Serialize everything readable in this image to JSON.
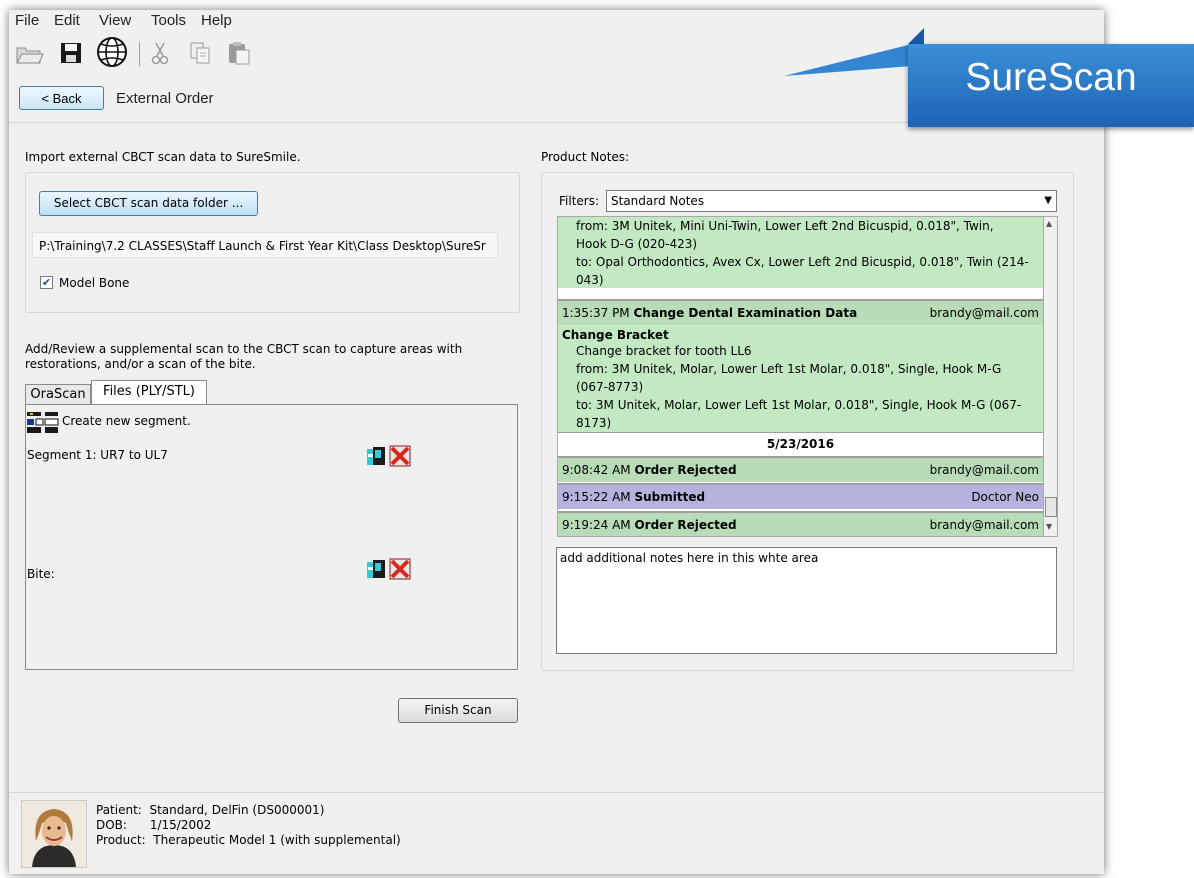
{
  "menu": [
    "File",
    "Edit",
    "View",
    "Tools",
    "Help"
  ],
  "toolbar": {
    "icons": [
      "open-folder-icon",
      "save-icon",
      "globe-icon",
      "cut-icon",
      "copy-icon",
      "paste-icon"
    ]
  },
  "header": {
    "back_label": "< Back",
    "title": "External Order"
  },
  "brand": {
    "name": "SureScan",
    "color": "#2373c4"
  },
  "left": {
    "import_label": "Import external CBCT scan data to SureSmile.",
    "select_button": "Select CBCT scan data folder ...",
    "path": "P:\\Training\\7.2 CLASSES\\Staff Launch & First Year Kit\\Class Desktop\\SureSr",
    "model_bone_label": "Model Bone",
    "model_bone_checked": true,
    "supplemental_text_line1": "Add/Review a supplemental scan to the CBCT scan to capture areas with",
    "supplemental_text_line2": "restorations, and/or a scan of the bite.",
    "tabs": [
      "OraScan",
      "Files (PLY/STL)"
    ],
    "active_tab": "Files (PLY/STL)",
    "create_segment": "Create new segment.",
    "segment_label": "Segment 1: UR7 to UL7",
    "bite_label": "Bite:",
    "finish_button": "Finish Scan"
  },
  "notes": {
    "title": "Product Notes:",
    "filters_label": "Filters:",
    "filter_value": "Standard Notes",
    "top_note_lines": [
      "from: 3M Unitek, Mini Uni-Twin, Lower Left 2nd Bicuspid, 0.018\", Twin,",
      "Hook D-G (020-423)",
      "to: Opal Orthodontics, Avex Cx, Lower Left 2nd Bicuspid, 0.018\", Twin (214-",
      "043)"
    ],
    "rows": [
      {
        "time": "1:35:37 PM",
        "event": "Change Dental Examination Data",
        "user": "brandy@mail.com"
      }
    ],
    "change_bracket": {
      "title": "Change Bracket",
      "lines": [
        "Change bracket for tooth LL6",
        "from: 3M Unitek, Molar, Lower Left 1st Molar, 0.018\", Single, Hook M-G",
        "(067-8773)",
        "to: 3M Unitek, Molar, Lower Left 1st Molar, 0.018\", Single, Hook M-G (067-",
        "8173)"
      ]
    },
    "date": "5/23/2016",
    "rows2": [
      {
        "time": "9:08:42 AM",
        "event": "Order Rejected",
        "user": "brandy@mail.com"
      },
      {
        "time": "9:15:22 AM",
        "event": "Submitted",
        "user": "Doctor Neo"
      },
      {
        "time": "9:19:24 AM",
        "event": "Order Rejected",
        "user": "brandy@mail.com"
      }
    ],
    "additional_notes": "add additional notes here in this whte area"
  },
  "patient": {
    "patient_label": "Patient:",
    "patient_value": "Standard, DelFin (DS000001)",
    "dob_label": "DOB:",
    "dob_value": "1/15/2002",
    "product_label": "Product:",
    "product_value": "Therapeutic Model 1 (with supplemental)"
  }
}
